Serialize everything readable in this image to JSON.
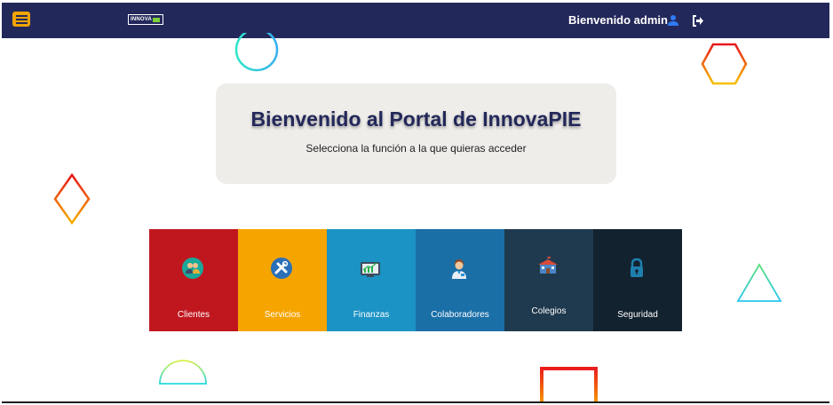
{
  "navbar": {
    "logo_text": "INNOVA",
    "welcome_text": "Bienvenido admin",
    "icons": {
      "menu": "hamburger-icon",
      "user": "user-icon",
      "logout": "logout-icon"
    },
    "color": "#23285a"
  },
  "hero": {
    "title": "Bienvenido al Portal de InnovaPIE",
    "subtitle": "Selecciona la función a la que quieras acceder"
  },
  "tiles": [
    {
      "label": "Clientes",
      "icon": "clients-icon",
      "color": "#c0171f"
    },
    {
      "label": "Servicios",
      "icon": "tools-icon",
      "color": "#f6a400"
    },
    {
      "label": "Finanzas",
      "icon": "finance-chart-icon",
      "color": "#1b93c4"
    },
    {
      "label": "Colaboradores",
      "icon": "collaborator-icon",
      "color": "#1a6fa7"
    },
    {
      "label": "Colegios",
      "icon": "school-icon",
      "color": "#1f3a4e"
    },
    {
      "label": "Seguridad",
      "icon": "lock-icon",
      "color": "#13222f"
    }
  ]
}
